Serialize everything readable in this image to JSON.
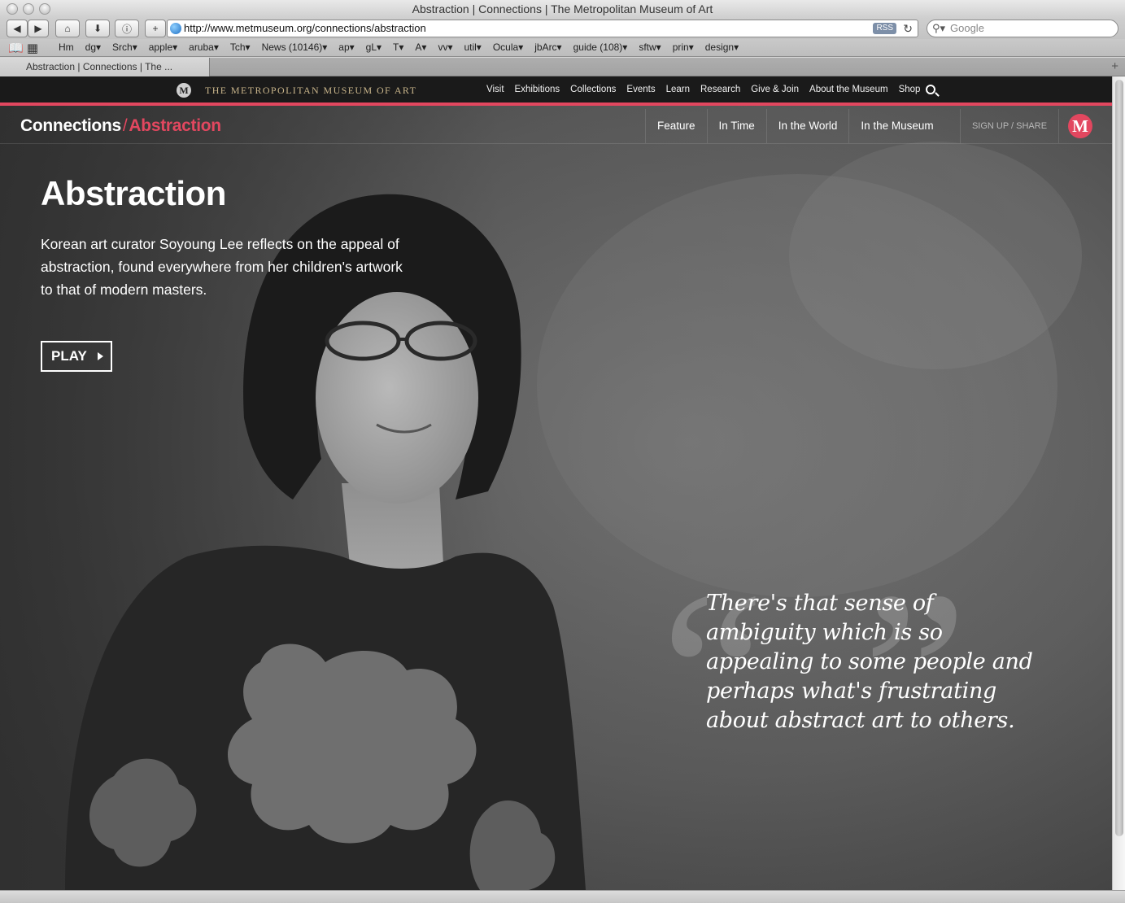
{
  "browser": {
    "window_title": "Abstraction | Connections | The Metropolitan Museum of Art",
    "url": "http://www.metmuseum.org/connections/abstraction",
    "rss_label": "RSS",
    "search_placeholder": "Google",
    "bookmarks": [
      "Hm",
      "dg▾",
      "Srch▾",
      "apple▾",
      "aruba▾",
      "Tch▾",
      "News (10146)▾",
      "ap▾",
      "gL▾",
      "T▾",
      "A▾",
      "vv▾",
      "util▾",
      "Ocula▾",
      "jbArc▾",
      "guide (108)▾",
      "sftw▾",
      "prin▾",
      "design▾"
    ],
    "tab_title": "Abstraction | Connections | The ..."
  },
  "met_header": {
    "logo_letter": "M",
    "museum_name": "THE METROPOLITAN MUSEUM OF ART",
    "nav": [
      "Visit",
      "Exhibitions",
      "Collections",
      "Events",
      "Learn",
      "Research",
      "Give & Join",
      "About the Museum",
      "Shop"
    ]
  },
  "sub_header": {
    "section": "Connections",
    "separator": "/",
    "current": "Abstraction",
    "nav": [
      "Feature",
      "In Time",
      "In the World",
      "In the Museum"
    ],
    "signup": "SIGN UP / SHARE",
    "badge_letter": "M"
  },
  "hero": {
    "title": "Abstraction",
    "description": "Korean art curator Soyoung Lee reflects on the appeal of abstraction, found everywhere from her children's artwork to that of modern masters.",
    "play_label": "PLAY",
    "quote": "There's that sense of ambiguity which is so appealing to some people and perhaps what's frustrating about abstract art to others."
  },
  "colors": {
    "accent": "#e2475f",
    "header_bg": "#1a1a1a",
    "met_gold": "#c9b58b"
  }
}
